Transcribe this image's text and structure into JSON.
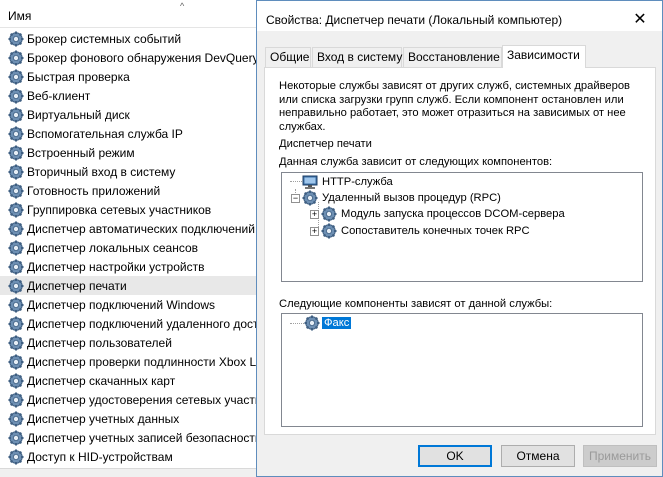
{
  "services_panel": {
    "column_header": "Имя",
    "sort_indicator": "^",
    "rows": [
      "Брокер системных событий",
      "Брокер фонового обнаружения DevQuery",
      "Быстрая проверка",
      "Веб-клиент",
      "Виртуальный диск",
      "Вспомогательная служба IP",
      "Встроенный режим",
      "Вторичный вход в систему",
      "Готовность приложений",
      "Группировка сетевых участников",
      "Диспетчер автоматических подключений",
      "Диспетчер локальных сеансов",
      "Диспетчер настройки устройств",
      "Диспетчер печати",
      "Диспетчер подключений Windows",
      "Диспетчер подключений удаленного доступа",
      "Диспетчер пользователей",
      "Диспетчер проверки подлинности Xbox Live",
      "Диспетчер скачанных карт",
      "Диспетчер удостоверения сетевых участников",
      "Диспетчер учетных данных",
      "Диспетчер учетных записей безопасности",
      "Доступ к HID-устройствам"
    ],
    "selected_row": "Диспетчер печати"
  },
  "dialog": {
    "title": "Свойства: Диспетчер печати (Локальный компьютер)",
    "close_glyph": "✕",
    "tabs": [
      "Общие",
      "Вход в систему",
      "Восстановление",
      "Зависимости"
    ],
    "active_tab": "Зависимости",
    "description_line1": "Некоторые службы зависят от других служб, системных драйверов",
    "description_line2": "или списка загрузки групп служб. Если компонент остановлен или",
    "description_line3": "неправильно работает, это может отразиться на зависимых от нее",
    "description_line4": "службах.",
    "service_name": "Диспетчер печати",
    "depends_on_label": "Данная служба зависит от следующих компонентов:",
    "depends_on_tree": {
      "http": "HTTP-служба",
      "rpc": "Удаленный вызов процедур (RPC)",
      "rpc_child1": "Модуль запуска процессов DCOM-сервера",
      "rpc_child2": "Сопоставитель конечных точек RPC"
    },
    "dependents_label": "Следующие компоненты зависят от данной службы:",
    "dependents_tree": {
      "fax": "Факс"
    },
    "buttons": {
      "ok": "OK",
      "cancel": "Отмена",
      "apply": "Применить"
    },
    "colors": {
      "selection": "#0078d7",
      "title_border": "#5f8dbd"
    }
  }
}
